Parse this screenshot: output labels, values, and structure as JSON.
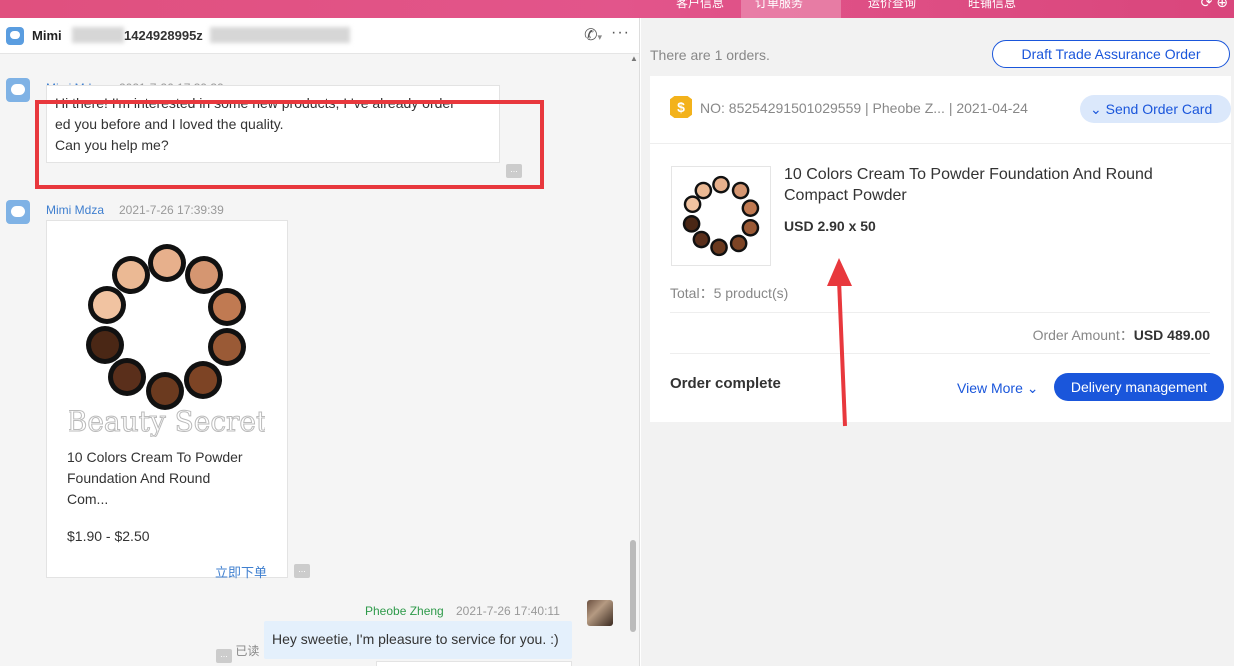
{
  "topbar": {
    "tabs": [
      "客户信息",
      "订单服务",
      "运价查询",
      "旺铺信息"
    ],
    "active_tab": "订单服务"
  },
  "chat": {
    "header": {
      "name": "Mimi",
      "masked_id": "1424928995z"
    },
    "messages": [
      {
        "sender": "Mimi Mdza",
        "time": "2021-7-26 17:39:39",
        "text_line1": "Hi there! I'm interested in some new products, I 've already order",
        "text_line2": "ed you before and I loved the quality.",
        "text_line3": "Can you help me?"
      },
      {
        "sender": "Mimi Mdza",
        "time": "2021-7-26 17:39:39",
        "product": {
          "title_line1": "10 Colors Cream To Powder",
          "title_line2": "Foundation And Round",
          "title_line3": "Com...",
          "price": "$1.90 - $2.50",
          "buy_label": "立即下单",
          "watermark": "Beauty Secret"
        }
      },
      {
        "sender": "Pheobe Zheng",
        "time": "2021-7-26 17:40:11",
        "text": "Hey sweetie, I'm pleasure to service for you. :)",
        "read_label": "已读"
      }
    ]
  },
  "orders": {
    "count_text": "There are 1 orders.",
    "draft_button": "Draft Trade Assurance Order",
    "card": {
      "order_no": "NO: 85254291501029559 | Pheobe Z... | 2021-04-24",
      "send_card": "Send Order Card",
      "product_title_line1": "10 Colors Cream To Powder Foundation And Round",
      "product_title_line2": "Compact Powder",
      "price": "USD 2.90 x 50",
      "total": "Total：5 product(s)",
      "amount_label": "Order Amount：",
      "amount_value": "USD 489.00",
      "status": "Order complete",
      "view_more": "View More",
      "delivery_button": "Delivery management"
    }
  },
  "colors": {
    "brand_pink": "#e2558b",
    "primary_blue": "#1a56db",
    "annotation_red": "#e8383d",
    "coin_gold": "#f3b21b"
  }
}
